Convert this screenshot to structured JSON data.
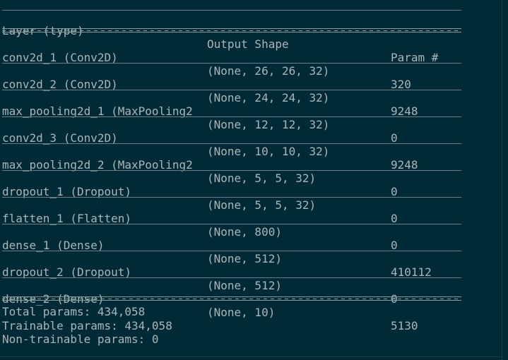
{
  "header": {
    "layer": "Layer (type)",
    "output_shape": "Output Shape",
    "params": "Param #"
  },
  "rows": [
    {
      "layer": "conv2d_1 (Conv2D)",
      "shape": "(None, 26, 26, 32)",
      "params": "320"
    },
    {
      "layer": "conv2d_2 (Conv2D)",
      "shape": "(None, 24, 24, 32)",
      "params": "9248"
    },
    {
      "layer": "max_pooling2d_1 (MaxPooling2",
      "shape": "(None, 12, 12, 32)",
      "params": "0"
    },
    {
      "layer": "conv2d_3 (Conv2D)",
      "shape": "(None, 10, 10, 32)",
      "params": "9248"
    },
    {
      "layer": "max_pooling2d_2 (MaxPooling2",
      "shape": "(None, 5, 5, 32)",
      "params": "0"
    },
    {
      "layer": "dropout_1 (Dropout)",
      "shape": "(None, 5, 5, 32)",
      "params": "0"
    },
    {
      "layer": "flatten_1 (Flatten)",
      "shape": "(None, 800)",
      "params": "0"
    },
    {
      "layer": "dense_1 (Dense)",
      "shape": "(None, 512)",
      "params": "410112"
    },
    {
      "layer": "dropout_2 (Dropout)",
      "shape": "(None, 512)",
      "params": "0"
    },
    {
      "layer": "dense_2 (Dense)",
      "shape": "(None, 10)",
      "params": "5130"
    }
  ],
  "summary": {
    "total": "Total params: 434,058",
    "trainable": "Trainable params: 434,058",
    "non_trainable": "Non-trainable params: 0"
  },
  "colors": {
    "background": "#002b36",
    "text": "#a8b6b9"
  }
}
